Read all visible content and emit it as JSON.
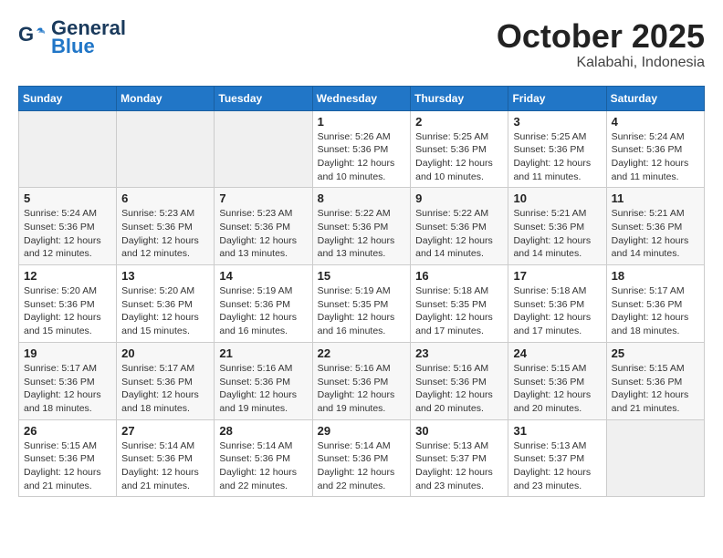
{
  "header": {
    "logo_line1": "General",
    "logo_line2": "Blue",
    "month": "October 2025",
    "location": "Kalabahi, Indonesia"
  },
  "weekdays": [
    "Sunday",
    "Monday",
    "Tuesday",
    "Wednesday",
    "Thursday",
    "Friday",
    "Saturday"
  ],
  "weeks": [
    [
      {
        "day": "",
        "info": ""
      },
      {
        "day": "",
        "info": ""
      },
      {
        "day": "",
        "info": ""
      },
      {
        "day": "1",
        "info": "Sunrise: 5:26 AM\nSunset: 5:36 PM\nDaylight: 12 hours\nand 10 minutes."
      },
      {
        "day": "2",
        "info": "Sunrise: 5:25 AM\nSunset: 5:36 PM\nDaylight: 12 hours\nand 10 minutes."
      },
      {
        "day": "3",
        "info": "Sunrise: 5:25 AM\nSunset: 5:36 PM\nDaylight: 12 hours\nand 11 minutes."
      },
      {
        "day": "4",
        "info": "Sunrise: 5:24 AM\nSunset: 5:36 PM\nDaylight: 12 hours\nand 11 minutes."
      }
    ],
    [
      {
        "day": "5",
        "info": "Sunrise: 5:24 AM\nSunset: 5:36 PM\nDaylight: 12 hours\nand 12 minutes."
      },
      {
        "day": "6",
        "info": "Sunrise: 5:23 AM\nSunset: 5:36 PM\nDaylight: 12 hours\nand 12 minutes."
      },
      {
        "day": "7",
        "info": "Sunrise: 5:23 AM\nSunset: 5:36 PM\nDaylight: 12 hours\nand 13 minutes."
      },
      {
        "day": "8",
        "info": "Sunrise: 5:22 AM\nSunset: 5:36 PM\nDaylight: 12 hours\nand 13 minutes."
      },
      {
        "day": "9",
        "info": "Sunrise: 5:22 AM\nSunset: 5:36 PM\nDaylight: 12 hours\nand 14 minutes."
      },
      {
        "day": "10",
        "info": "Sunrise: 5:21 AM\nSunset: 5:36 PM\nDaylight: 12 hours\nand 14 minutes."
      },
      {
        "day": "11",
        "info": "Sunrise: 5:21 AM\nSunset: 5:36 PM\nDaylight: 12 hours\nand 14 minutes."
      }
    ],
    [
      {
        "day": "12",
        "info": "Sunrise: 5:20 AM\nSunset: 5:36 PM\nDaylight: 12 hours\nand 15 minutes."
      },
      {
        "day": "13",
        "info": "Sunrise: 5:20 AM\nSunset: 5:36 PM\nDaylight: 12 hours\nand 15 minutes."
      },
      {
        "day": "14",
        "info": "Sunrise: 5:19 AM\nSunset: 5:36 PM\nDaylight: 12 hours\nand 16 minutes."
      },
      {
        "day": "15",
        "info": "Sunrise: 5:19 AM\nSunset: 5:35 PM\nDaylight: 12 hours\nand 16 minutes."
      },
      {
        "day": "16",
        "info": "Sunrise: 5:18 AM\nSunset: 5:35 PM\nDaylight: 12 hours\nand 17 minutes."
      },
      {
        "day": "17",
        "info": "Sunrise: 5:18 AM\nSunset: 5:36 PM\nDaylight: 12 hours\nand 17 minutes."
      },
      {
        "day": "18",
        "info": "Sunrise: 5:17 AM\nSunset: 5:36 PM\nDaylight: 12 hours\nand 18 minutes."
      }
    ],
    [
      {
        "day": "19",
        "info": "Sunrise: 5:17 AM\nSunset: 5:36 PM\nDaylight: 12 hours\nand 18 minutes."
      },
      {
        "day": "20",
        "info": "Sunrise: 5:17 AM\nSunset: 5:36 PM\nDaylight: 12 hours\nand 18 minutes."
      },
      {
        "day": "21",
        "info": "Sunrise: 5:16 AM\nSunset: 5:36 PM\nDaylight: 12 hours\nand 19 minutes."
      },
      {
        "day": "22",
        "info": "Sunrise: 5:16 AM\nSunset: 5:36 PM\nDaylight: 12 hours\nand 19 minutes."
      },
      {
        "day": "23",
        "info": "Sunrise: 5:16 AM\nSunset: 5:36 PM\nDaylight: 12 hours\nand 20 minutes."
      },
      {
        "day": "24",
        "info": "Sunrise: 5:15 AM\nSunset: 5:36 PM\nDaylight: 12 hours\nand 20 minutes."
      },
      {
        "day": "25",
        "info": "Sunrise: 5:15 AM\nSunset: 5:36 PM\nDaylight: 12 hours\nand 21 minutes."
      }
    ],
    [
      {
        "day": "26",
        "info": "Sunrise: 5:15 AM\nSunset: 5:36 PM\nDaylight: 12 hours\nand 21 minutes."
      },
      {
        "day": "27",
        "info": "Sunrise: 5:14 AM\nSunset: 5:36 PM\nDaylight: 12 hours\nand 21 minutes."
      },
      {
        "day": "28",
        "info": "Sunrise: 5:14 AM\nSunset: 5:36 PM\nDaylight: 12 hours\nand 22 minutes."
      },
      {
        "day": "29",
        "info": "Sunrise: 5:14 AM\nSunset: 5:36 PM\nDaylight: 12 hours\nand 22 minutes."
      },
      {
        "day": "30",
        "info": "Sunrise: 5:13 AM\nSunset: 5:37 PM\nDaylight: 12 hours\nand 23 minutes."
      },
      {
        "day": "31",
        "info": "Sunrise: 5:13 AM\nSunset: 5:37 PM\nDaylight: 12 hours\nand 23 minutes."
      },
      {
        "day": "",
        "info": ""
      }
    ]
  ]
}
